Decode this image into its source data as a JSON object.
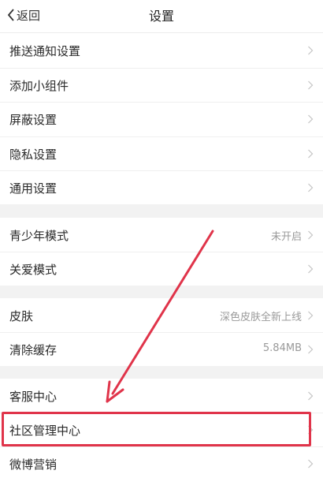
{
  "nav": {
    "back_label": "返回",
    "title": "设置"
  },
  "rows": [
    {
      "label": "推送通知设置",
      "value": ""
    },
    {
      "label": "添加小组件",
      "value": ""
    },
    {
      "label": "屏蔽设置",
      "value": ""
    },
    {
      "label": "隐私设置",
      "value": ""
    },
    {
      "label": "通用设置",
      "value": ""
    },
    {
      "label": "青少年模式",
      "value": "未开启"
    },
    {
      "label": "关爱模式",
      "value": ""
    },
    {
      "label": "皮肤",
      "value": "深色皮肤全新上线"
    },
    {
      "label": "清除缓存",
      "value": "5.84MB"
    },
    {
      "label": "客服中心",
      "value": ""
    },
    {
      "label": "社区管理中心",
      "value": ""
    },
    {
      "label": "微博营销",
      "value": ""
    }
  ],
  "colors": {
    "highlight": "#e0344a",
    "band": "#f2f2f2"
  },
  "icons": {
    "back": "chevron-left-icon",
    "row": "chevron-right-icon"
  }
}
